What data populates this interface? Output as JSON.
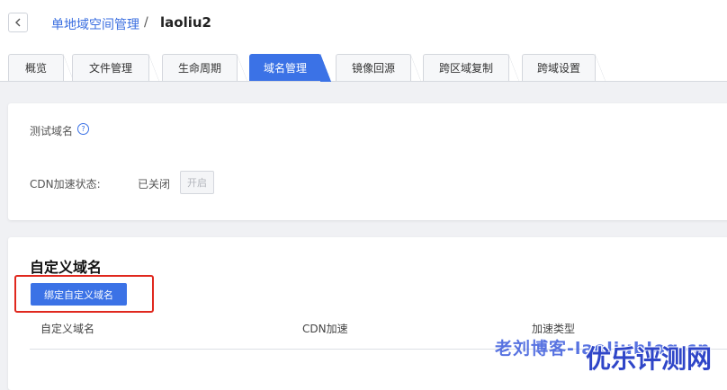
{
  "breadcrumb": {
    "parent": "单地域空间管理",
    "separator": "/",
    "current": "laoliu2"
  },
  "tabs": [
    {
      "label": "概览"
    },
    {
      "label": "文件管理"
    },
    {
      "label": "生命周期"
    },
    {
      "label": "域名管理",
      "active": true
    },
    {
      "label": "镜像回源"
    },
    {
      "label": "跨区域复制"
    },
    {
      "label": "跨域设置"
    }
  ],
  "test_domain": {
    "label": "测试域名",
    "help_icon": "question-circle-icon"
  },
  "cdn": {
    "label": "CDN加速状态:",
    "status": "已关闭",
    "enable_button": "开启"
  },
  "custom_domain": {
    "title": "自定义域名",
    "bind_button": "绑定自定义域名",
    "columns": [
      "自定义域名",
      "CDN加速",
      "加速类型"
    ]
  },
  "watermark": {
    "line1": "老刘博客-laoliublog.cn",
    "line2": "优乐评测网"
  },
  "colors": {
    "accent": "#3b72e6",
    "highlight": "#e0281e"
  }
}
